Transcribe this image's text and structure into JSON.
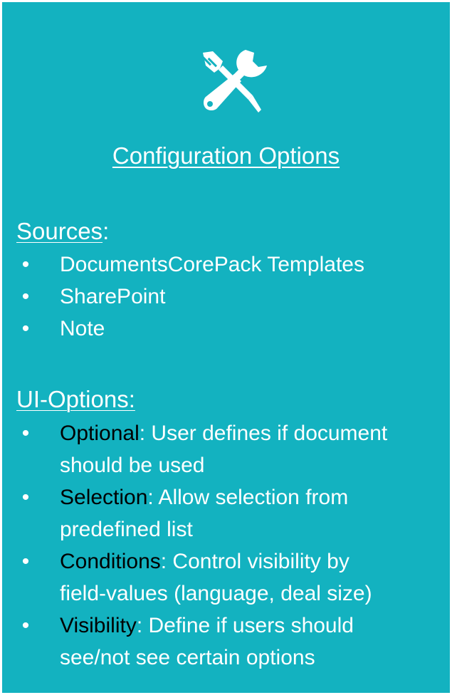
{
  "title": "Configuration Options",
  "icon": "tools-icon",
  "colors": {
    "panel_background": "#13b2c0",
    "text": "#ffffff",
    "term_text": "#000000"
  },
  "sources": {
    "heading_word": "Sources",
    "heading_suffix": ":",
    "items": [
      "DocumentsCorePack Templates",
      "SharePoint",
      "Note"
    ]
  },
  "ui_options": {
    "heading": "UI-Options:",
    "items": [
      {
        "term": "Optional",
        "line1": ": User defines if document",
        "line2": "should be used"
      },
      {
        "term": "Selection",
        "line1": ": Allow selection from",
        "line2": "predefined list"
      },
      {
        "term": "Conditions",
        "line1": ": Control visibility by",
        "line2": "field-values (language, deal size)"
      },
      {
        "term": "Visibility",
        "line1": ": Define if users should",
        "line2": "see/not see certain options"
      }
    ]
  },
  "bullet_char": "•"
}
